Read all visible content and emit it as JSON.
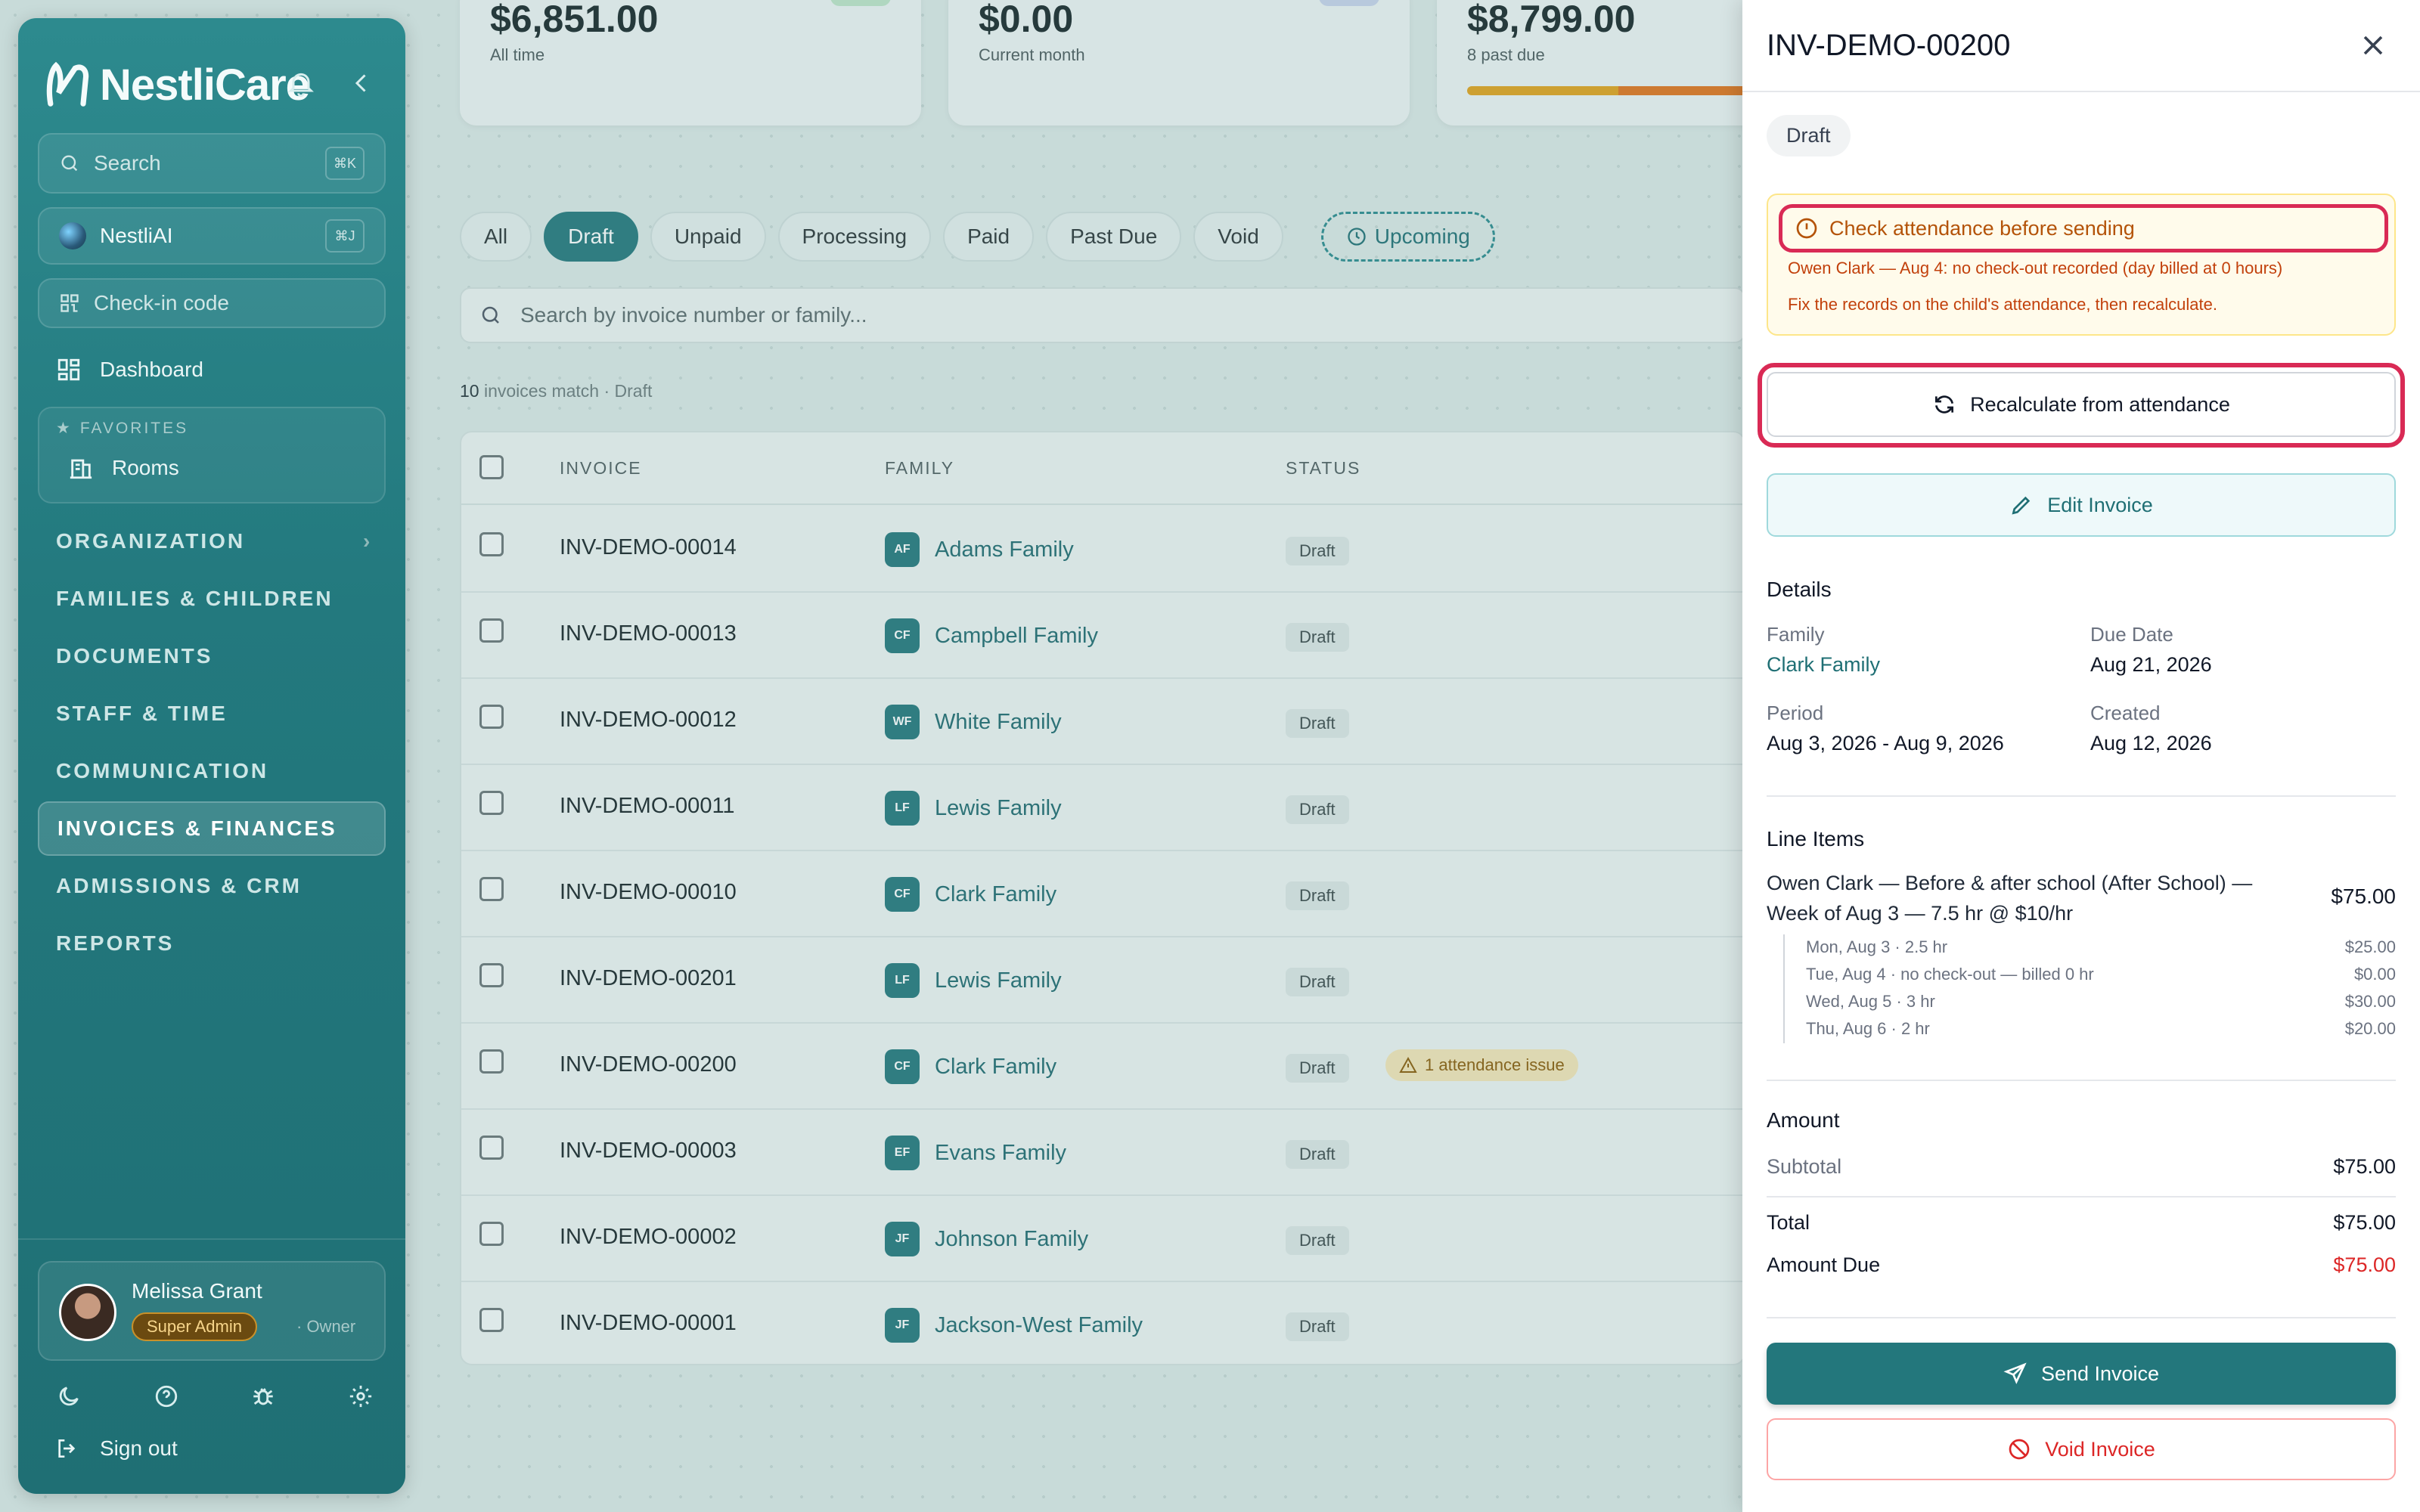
{
  "app": {
    "logo_text": "NestliCare"
  },
  "sidebar": {
    "search_label": "Search",
    "search_kbd": "⌘K",
    "ai_label": "NestliAI",
    "ai_kbd": "⌘J",
    "checkin_label": "Check-in code",
    "dashboard_label": "Dashboard",
    "favorites_label": "FAVORITES",
    "fav_rooms": "Rooms",
    "sections": [
      "ORGANIZATION",
      "FAMILIES & CHILDREN",
      "DOCUMENTS",
      "STAFF & TIME",
      "COMMUNICATION",
      "INVOICES & FINANCES",
      "ADMISSIONS & CRM",
      "REPORTS"
    ],
    "active_section": "INVOICES & FINANCES",
    "user": {
      "name": "Melissa Grant",
      "role": "Super Admin",
      "suffix": "· Owner"
    },
    "signout": "Sign out"
  },
  "stats": [
    {
      "amount": "$6,851.00",
      "label": "All time"
    },
    {
      "amount": "$0.00",
      "label": "Current month"
    },
    {
      "amount": "$8,799.00",
      "label": "8 past due"
    }
  ],
  "filters": [
    "All",
    "Draft",
    "Unpaid",
    "Processing",
    "Paid",
    "Past Due",
    "Void"
  ],
  "active_filter": "Draft",
  "upcoming_label": "Upcoming",
  "search_placeholder": "Search by invoice number or family...",
  "match": {
    "count": "10",
    "text": "invoices match · Draft"
  },
  "table": {
    "headers": [
      "INVOICE",
      "FAMILY",
      "STATUS"
    ],
    "rows": [
      {
        "inv": "INV-DEMO-00014",
        "initials": "AF",
        "family": "Adams Family",
        "status": "Draft",
        "issue": ""
      },
      {
        "inv": "INV-DEMO-00013",
        "initials": "CF",
        "family": "Campbell Family",
        "status": "Draft",
        "issue": ""
      },
      {
        "inv": "INV-DEMO-00012",
        "initials": "WF",
        "family": "White Family",
        "status": "Draft",
        "issue": ""
      },
      {
        "inv": "INV-DEMO-00011",
        "initials": "LF",
        "family": "Lewis Family",
        "status": "Draft",
        "issue": ""
      },
      {
        "inv": "INV-DEMO-00010",
        "initials": "CF",
        "family": "Clark Family",
        "status": "Draft",
        "issue": ""
      },
      {
        "inv": "INV-DEMO-00201",
        "initials": "LF",
        "family": "Lewis Family",
        "status": "Draft",
        "issue": ""
      },
      {
        "inv": "INV-DEMO-00200",
        "initials": "CF",
        "family": "Clark Family",
        "status": "Draft",
        "issue": "1 attendance issue"
      },
      {
        "inv": "INV-DEMO-00003",
        "initials": "EF",
        "family": "Evans Family",
        "status": "Draft",
        "issue": ""
      },
      {
        "inv": "INV-DEMO-00002",
        "initials": "JF",
        "family": "Johnson Family",
        "status": "Draft",
        "issue": ""
      },
      {
        "inv": "INV-DEMO-00001",
        "initials": "JF",
        "family": "Jackson-West Family",
        "status": "Draft",
        "issue": ""
      }
    ]
  },
  "panel": {
    "title": "INV-DEMO-00200",
    "status": "Draft",
    "warning": {
      "title": "Check attendance before sending",
      "line1": "Owen Clark — Aug 4: no check-out recorded (day billed at 0 hours)",
      "line2": "Fix the records on the child's attendance, then recalculate."
    },
    "recalc_label": "Recalculate from attendance",
    "edit_label": "Edit Invoice",
    "details_heading": "Details",
    "details": {
      "family_label": "Family",
      "family_value": "Clark Family",
      "due_label": "Due Date",
      "due_value": "Aug 21, 2026",
      "period_label": "Period",
      "period_value": "Aug 3, 2026 - Aug 9, 2026",
      "created_label": "Created",
      "created_value": "Aug 12, 2026"
    },
    "line_items_heading": "Line Items",
    "line_item": {
      "desc": "Owen Clark — Before & after school (After School) — Week of Aug 3 — 7.5 hr @ $10/hr",
      "amount": "$75.00",
      "days": [
        {
          "label": "Mon, Aug 3 · 2.5 hr",
          "amount": "$25.00"
        },
        {
          "label": "Tue, Aug 4 · no check-out — billed 0 hr",
          "amount": "$0.00"
        },
        {
          "label": "Wed, Aug 5 · 3 hr",
          "amount": "$30.00"
        },
        {
          "label": "Thu, Aug 6 · 2 hr",
          "amount": "$20.00"
        }
      ]
    },
    "amount_heading": "Amount",
    "subtotal_label": "Subtotal",
    "subtotal": "$75.00",
    "total_label": "Total",
    "total": "$75.00",
    "due_label": "Amount Due",
    "due": "$75.00",
    "send_label": "Send Invoice",
    "void_label": "Void Invoice"
  },
  "colors": {
    "brand": "#23777c",
    "highlight": "#d92a55",
    "danger": "#dc2626",
    "warning_bg": "#fffbeb"
  }
}
